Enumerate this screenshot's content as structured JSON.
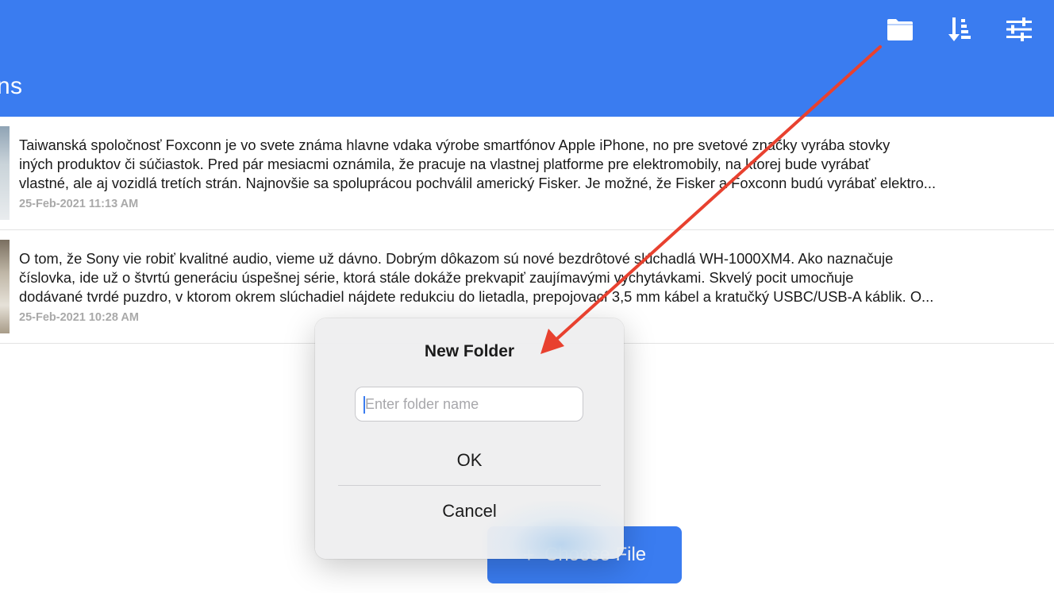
{
  "header": {
    "title": "ns",
    "background": "#3a7cf0",
    "icons": [
      "folder-icon",
      "sort-icon",
      "filter-icon"
    ]
  },
  "notes": [
    {
      "lines": [
        " Taiwanská spoločnosť Foxconn je vo svete známa hlavne vdaka  výrobe smartfónov Apple iPhone, no pre svetové značky vyrába  stovky",
        "iných produktov či súčiastok. Pred pár mesiacmi oznámila, že  pracuje na vlastnej platforme pre elektromobily, na ktorej bude  vyrábať",
        "vlastné, ale aj vozidlá tretích strán. Najnovšie sa  spoluprácou pochválil americký Fisker. Je možné, že Fisker a  Foxconn budú vyrábať elektro..."
      ],
      "date": "25-Feb-2021 11:13 AM"
    },
    {
      "lines": [
        " O tom, že Sony vie robiť kvalitné audio, vieme už dávno. Dobrým dôkazom  sú nové bezdrôtové slúchadlá WH-1000XM4. Ako naznačuje",
        "číslovka, ide už  o štvrtú generáciu úspešnej série, ktorá stále dokáže prekvapiť zaujímavými  vychytávkami. Skvelý pocit umocňuje",
        "dodávané tvrdé puzdro, v ktorom okrem  slúchadiel nájdete redukciu do lietadla, prepojovací 3,5 mm kábel a kratučký  USBC/USB-A káblik. O..."
      ],
      "date": "25-Feb-2021 10:28 AM"
    }
  ],
  "choose_file": {
    "plus": "+",
    "label": "Choose File"
  },
  "dialog": {
    "title": "New Folder",
    "input_value": "",
    "input_placeholder": "Enter folder name",
    "ok_label": "OK",
    "cancel_label": "Cancel"
  },
  "annotation": {
    "arrow_color": "#e8412f"
  }
}
